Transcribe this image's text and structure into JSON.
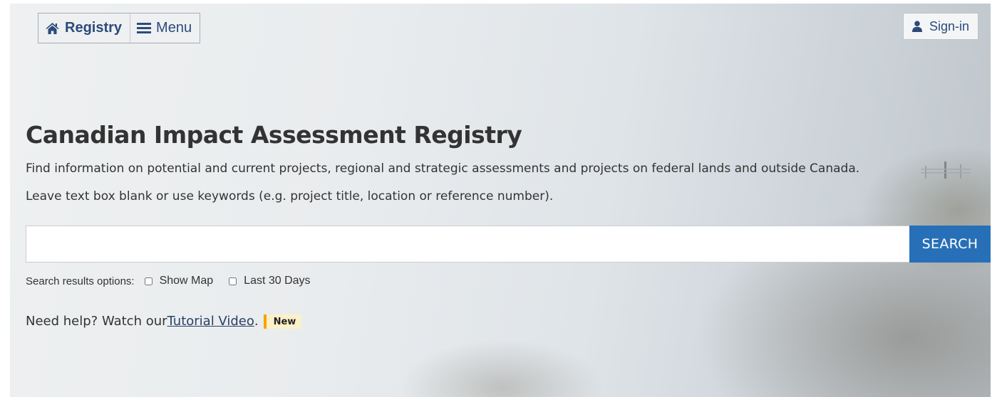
{
  "nav": {
    "registry_label": "Registry",
    "menu_label": "Menu",
    "signin_label": "Sign-in"
  },
  "hero": {
    "title": "Canadian Impact Assessment Registry",
    "lead_1": "Find information on potential and current projects, regional and strategic assessments and projects on federal lands and outside Canada.",
    "lead_2": "Leave text box blank or use keywords (e.g. project title, location or reference number)."
  },
  "search": {
    "value": "",
    "placeholder": "",
    "button_label": "SEARCH"
  },
  "options": {
    "label": "Search results options:",
    "show_map_label": "Show Map",
    "show_map_checked": false,
    "last30_label": "Last 30 Days",
    "last30_checked": false
  },
  "help": {
    "prefix": "Need help? Watch our ",
    "link_text": "Tutorial Video",
    "suffix": ".",
    "badge": "New"
  },
  "colors": {
    "accent": "#2770b8",
    "nav_text": "#2c4a7a",
    "badge_bar": "#f5a300",
    "badge_bg": "#fbf1c8"
  }
}
